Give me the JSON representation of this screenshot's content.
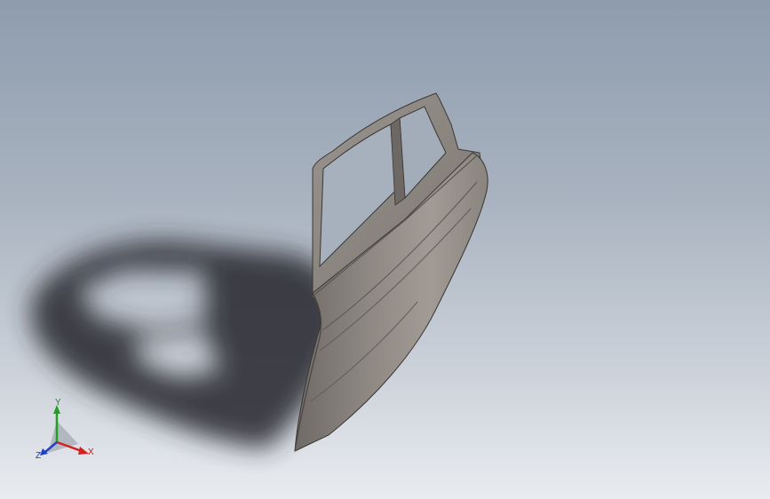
{
  "viewport": {
    "background_top": "#8e9cad",
    "background_bottom": "#e9ecf0"
  },
  "model": {
    "part": "rear car door",
    "body_color": "#8f8984",
    "shadow_color": "#2a2c30"
  },
  "triad": {
    "x_label": "X",
    "y_label": "Y",
    "z_label": "Z",
    "x_color": "#d42020",
    "y_color": "#1fa01f",
    "z_color": "#2040c8"
  }
}
